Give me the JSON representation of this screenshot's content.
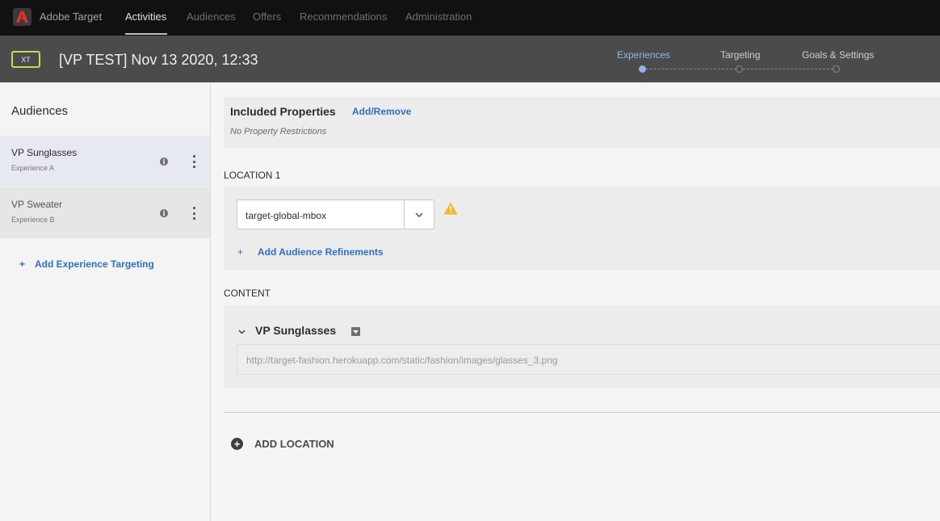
{
  "app": {
    "name": "Adobe Target"
  },
  "nav": {
    "items": [
      "Activities",
      "Audiences",
      "Offers",
      "Recommendations",
      "Administration"
    ],
    "active": "Activities"
  },
  "activity": {
    "badge": "XT",
    "title": "[VP TEST] Nov 13 2020, 12:33"
  },
  "steps": [
    {
      "label": "Experiences",
      "active": true
    },
    {
      "label": "Targeting",
      "active": false
    },
    {
      "label": "Goals & Settings",
      "active": false
    }
  ],
  "sidebar": {
    "title": "Audiences",
    "items": [
      {
        "name": "VP Sunglasses",
        "sub": "Experience A",
        "selected": true
      },
      {
        "name": "VP Sweater",
        "sub": "Experience B",
        "selected": false
      }
    ],
    "add_label": "Add Experience Targeting",
    "add_plus": "+"
  },
  "properties": {
    "title": "Included Properties",
    "link": "Add/Remove",
    "note": "No Property Restrictions"
  },
  "location": {
    "label": "LOCATION 1",
    "mbox": "target-global-mbox",
    "refine_plus": "+",
    "refine_label": "Add Audience Refinements",
    "warning_icon": "warning-triangle-icon"
  },
  "content": {
    "label": "CONTENT",
    "experience": "VP Sunglasses",
    "url": "http://target-fashion.herokuapp.com/static/fashion/images/glasses_3.png"
  },
  "add_location": {
    "icon": "+",
    "label": "ADD LOCATION"
  },
  "colors": {
    "accent": "#2d6fc2",
    "active_step": "#8fb6ee",
    "badge_border": "#d2d55a",
    "warning": "#f2b824"
  }
}
